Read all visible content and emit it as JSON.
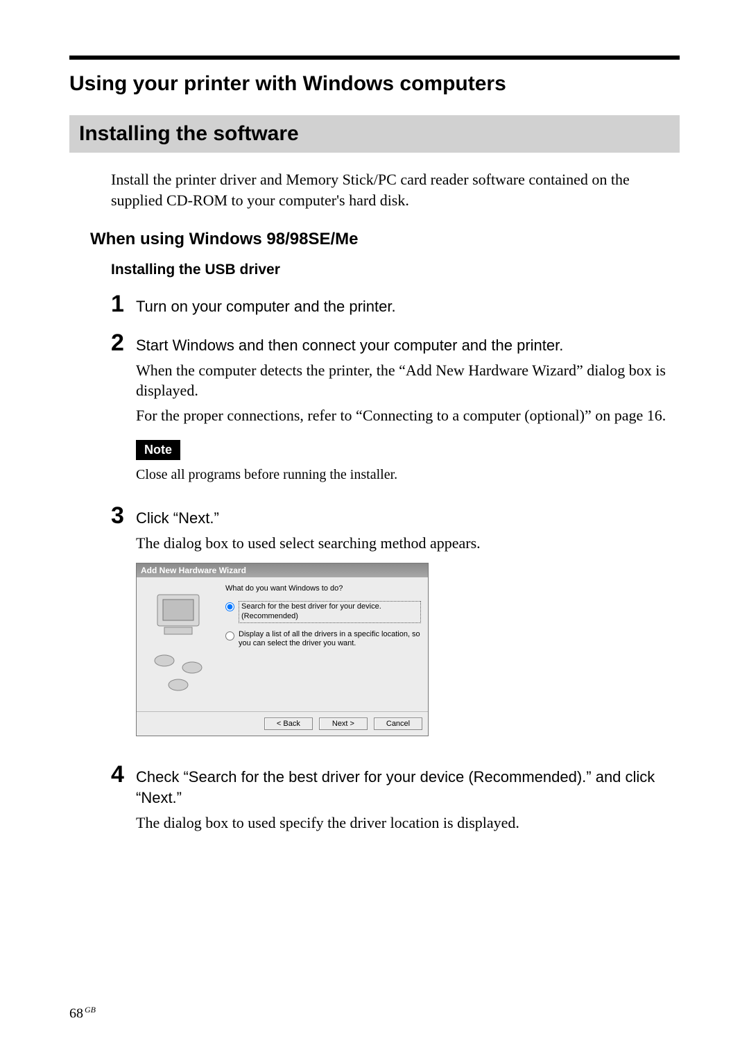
{
  "page": {
    "number": "68",
    "region": "GB"
  },
  "headings": {
    "main": "Using your printer with Windows computers",
    "section": "Installing the software",
    "intro": "Install the printer driver and Memory Stick/PC card reader software contained on the supplied CD-ROM to your computer's hard disk.",
    "sub": "When using Windows 98/98SE/Me",
    "subsub": "Installing the USB driver"
  },
  "steps": {
    "s1": {
      "num": "1",
      "title": "Turn on your computer and the printer."
    },
    "s2": {
      "num": "2",
      "title": "Start Windows and then connect your computer and the printer.",
      "p1": "When the computer detects the printer, the “Add New Hardware Wizard” dialog box is displayed.",
      "p2": "For the proper connections, refer to “Connecting to a computer (optional)” on page 16.",
      "note_label": "Note",
      "note_text": "Close all programs before running the installer."
    },
    "s3": {
      "num": "3",
      "title": "Click “Next.”",
      "p1": "The dialog box to used select searching method appears."
    },
    "s4": {
      "num": "4",
      "title": "Check “Search for the best driver for your device (Recommended).” and click “Next.”",
      "p1": "The dialog box to used specify the driver location is displayed."
    }
  },
  "wizard": {
    "title": "Add New Hardware Wizard",
    "prompt": "What do you want Windows to do?",
    "opt1": "Search for the best driver for your device. (Recommended)",
    "opt2": "Display a list of all the drivers in a specific location, so you can select the driver you want.",
    "buttons": {
      "back": "< Back",
      "next": "Next >",
      "cancel": "Cancel"
    }
  }
}
